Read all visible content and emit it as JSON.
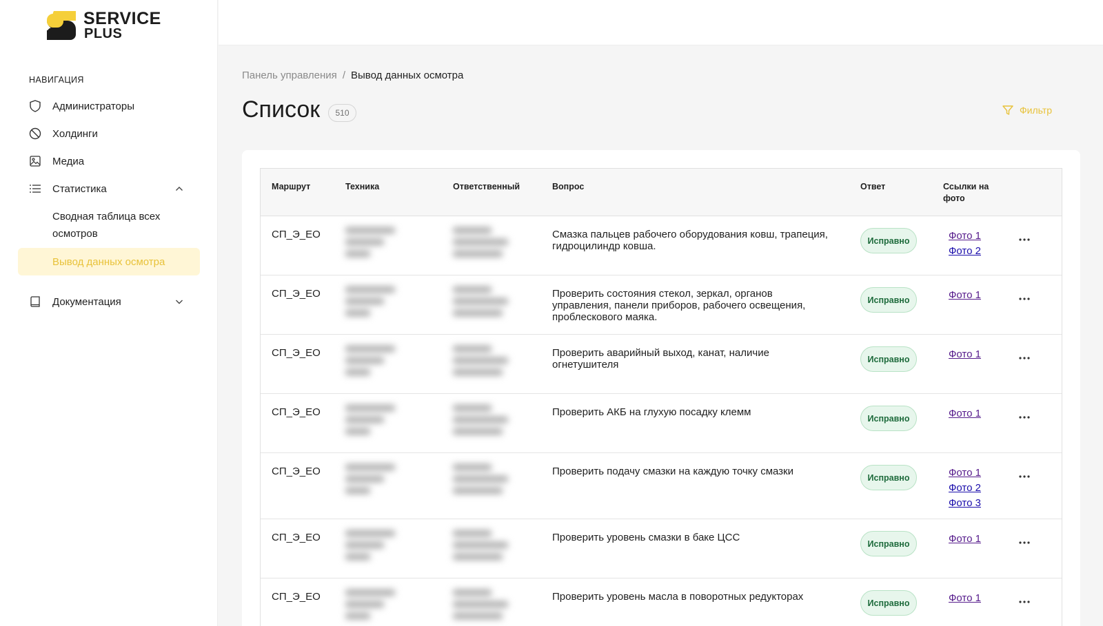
{
  "brand": {
    "line1": "SERVICE",
    "line2": "PLUS",
    "logo_color": "#f5cf3a"
  },
  "nav": {
    "heading": "НАВИГАЦИЯ",
    "items": [
      {
        "label": "Администраторы",
        "icon": "shield-icon"
      },
      {
        "label": "Холдинги",
        "icon": "ban-icon"
      },
      {
        "label": "Медиа",
        "icon": "image-icon"
      },
      {
        "label": "Статистика",
        "icon": "list-icon",
        "expanded": true
      },
      {
        "label": "Документация",
        "icon": "book-icon",
        "expanded": false
      }
    ],
    "stat_sub": [
      {
        "label": "Сводная таблица всех осмотров"
      },
      {
        "label": "Вывод данных осмотра",
        "active": true
      }
    ]
  },
  "breadcrumb": {
    "root": "Панель управления",
    "separator": "/",
    "current": "Вывод данных осмотра"
  },
  "page": {
    "title": "Список",
    "count": "510",
    "filter_label": "Фильтр",
    "accent": "#e8c23a"
  },
  "table": {
    "headers": {
      "route": "Маршрут",
      "equipment": "Техника",
      "responsible": "Ответственный",
      "question": "Вопрос",
      "answer": "Ответ",
      "photos": "Ссылки на фото"
    },
    "rows": [
      {
        "route": "СП_Э_ЕО",
        "question": "Смазка пальцев рабочего оборудования ковш, трапеция, гидроцилиндр ковша.",
        "answer": "Исправно",
        "photos": [
          "Фото 1",
          "Фото 2"
        ]
      },
      {
        "route": "СП_Э_ЕО",
        "question": "Проверить состояния стекол, зеркал, органов управления, панели приборов, рабочего освещения, проблескового маяка.",
        "answer": "Исправно",
        "photos": [
          "Фото 1"
        ]
      },
      {
        "route": "СП_Э_ЕО",
        "question": "Проверить аварийный выход, канат, наличие огнетушителя",
        "answer": "Исправно",
        "photos": [
          "Фото 1"
        ]
      },
      {
        "route": "СП_Э_ЕО",
        "question": "Проверить АКБ на глухую посадку клемм",
        "answer": "Исправно",
        "photos": [
          "Фото 1"
        ]
      },
      {
        "route": "СП_Э_ЕО",
        "question": "Проверить подачу смазки на каждую точку смазки",
        "answer": "Исправно",
        "photos": [
          "Фото 1",
          "Фото 2",
          "Фото 3"
        ]
      },
      {
        "route": "СП_Э_ЕО",
        "question": "Проверить уровень смазки в баке ЦСС",
        "answer": "Исправно",
        "photos": [
          "Фото 1"
        ]
      },
      {
        "route": "СП_Э_ЕО",
        "question": "Проверить уровень масла в поворотных редукторах",
        "answer": "Исправно",
        "photos": [
          "Фото 1"
        ]
      }
    ]
  }
}
